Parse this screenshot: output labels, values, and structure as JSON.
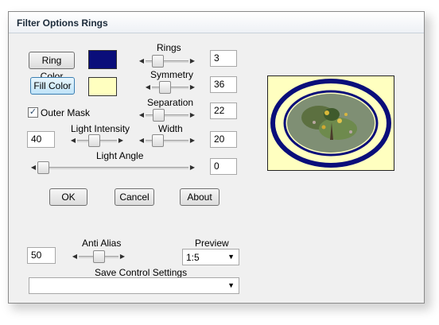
{
  "window": {
    "title": "Filter Options Rings"
  },
  "colors": {
    "ring": "#0a0e7a",
    "fill": "#ffffc0",
    "preview_bg": "#ffffc0"
  },
  "buttons": {
    "ring_color": "Ring Color",
    "fill_color": "Fill Color",
    "ok": "OK",
    "cancel": "Cancel",
    "about": "About"
  },
  "outer_mask": {
    "label": "Outer Mask",
    "checked": true,
    "check_glyph": "✓"
  },
  "controls": {
    "rings": {
      "label": "Rings",
      "value": "3",
      "level": 0.2
    },
    "symmetry": {
      "label": "Symmetry",
      "value": "36",
      "level": 0.3
    },
    "separation": {
      "label": "Separation",
      "value": "22",
      "level": 0.22
    },
    "light_intensity": {
      "label": "Light Intensity",
      "value": "40",
      "level": 0.4
    },
    "width": {
      "label": "Width",
      "value": "20",
      "level": 0.2
    },
    "light_angle": {
      "label": "Light Angle",
      "value": "0",
      "level": 0.0
    },
    "anti_alias": {
      "label": "Anti Alias",
      "value": "50",
      "level": 0.5
    }
  },
  "preview": {
    "label": "Preview",
    "value": "1:5"
  },
  "save_settings": {
    "label": "Save Control Settings",
    "value": ""
  },
  "icons": {
    "left_arrow": "◀",
    "right_arrow": "▶",
    "dropdown": "▼"
  }
}
